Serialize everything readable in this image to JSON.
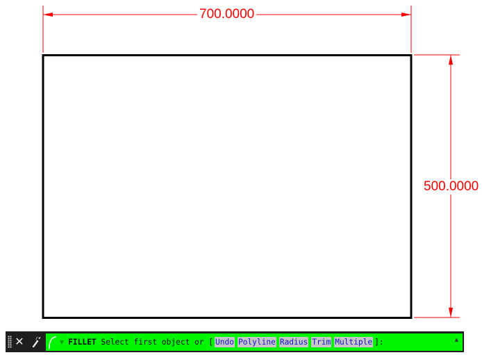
{
  "drawing": {
    "width_dimension": "700.0000",
    "height_dimension": "500.0000",
    "colors": {
      "dimension": "#ff0000",
      "object": "#000000",
      "background": "#ffffff"
    }
  },
  "command_line": {
    "close_icon": "✕",
    "customize_icon": "wrench-icon",
    "recent_commands_icon": "command-prompt-icon",
    "recent_commands_arrow": "▼",
    "command": "FILLET",
    "prompt": "Select first object or [",
    "options": [
      "Undo",
      "Polyline",
      "Radius",
      "Trim",
      "Multiple"
    ],
    "prompt_end": "]:",
    "scroll_icon": "▲",
    "colors": {
      "bar": "#00f500",
      "option_bg": "#c6c6c6",
      "option_text": "#1515c8"
    }
  }
}
